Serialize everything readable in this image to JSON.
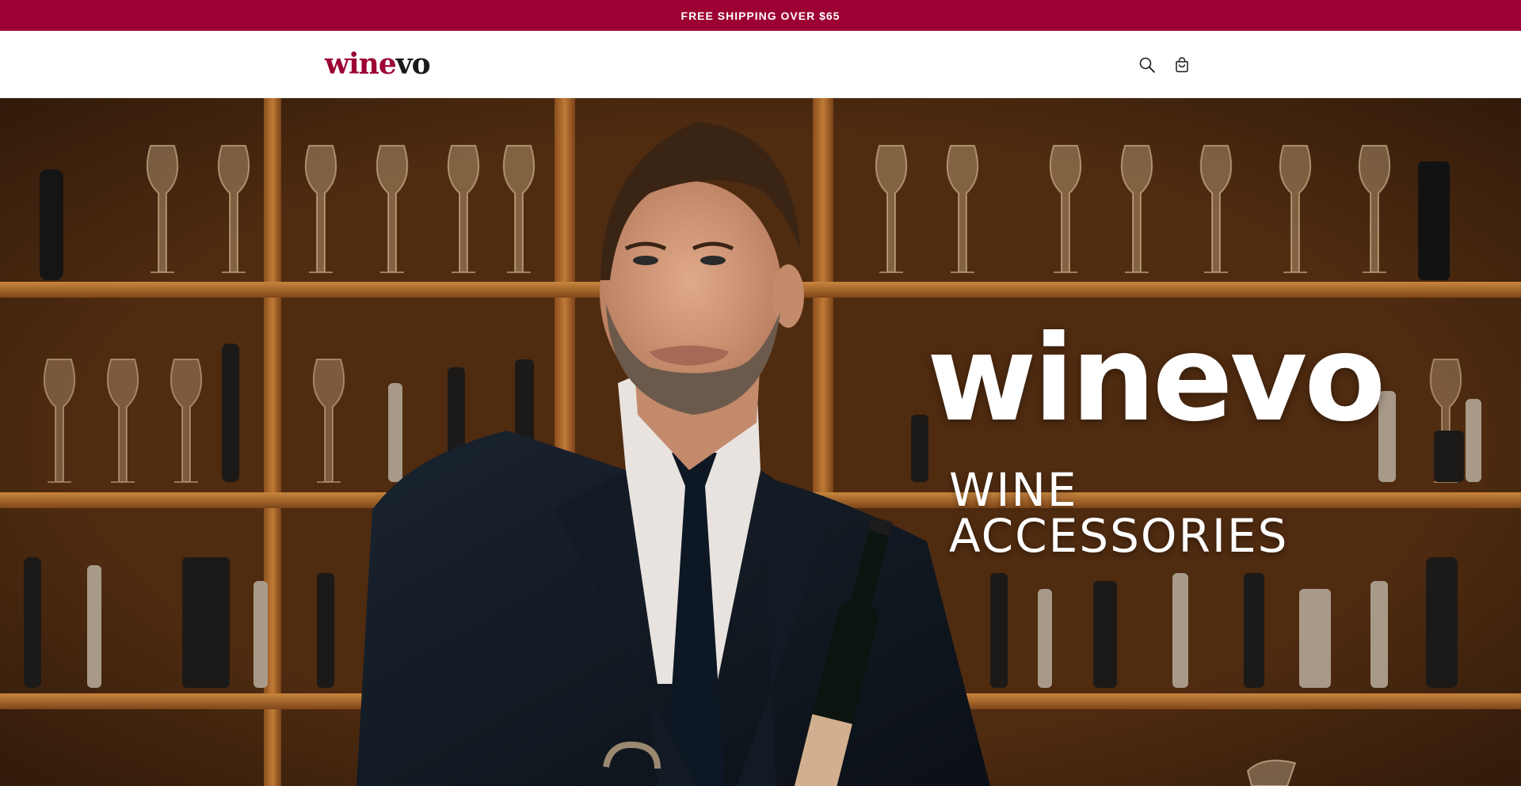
{
  "announcement": {
    "text": "FREE SHIPPING OVER $65"
  },
  "header": {
    "logo": {
      "part_a": "wine",
      "part_b": "vo"
    },
    "icons": {
      "search": "search-icon",
      "cart": "cart-icon"
    }
  },
  "hero": {
    "brand": "winevo",
    "tagline": "WINE ACCESSORIES",
    "image": "sommelier-holding-wine-bottle-and-bottle-opener"
  },
  "colors": {
    "brand": "#9d0033",
    "text_dark": "#1a1a1a",
    "hero_text": "#ffffff",
    "wood": "#b87333"
  }
}
